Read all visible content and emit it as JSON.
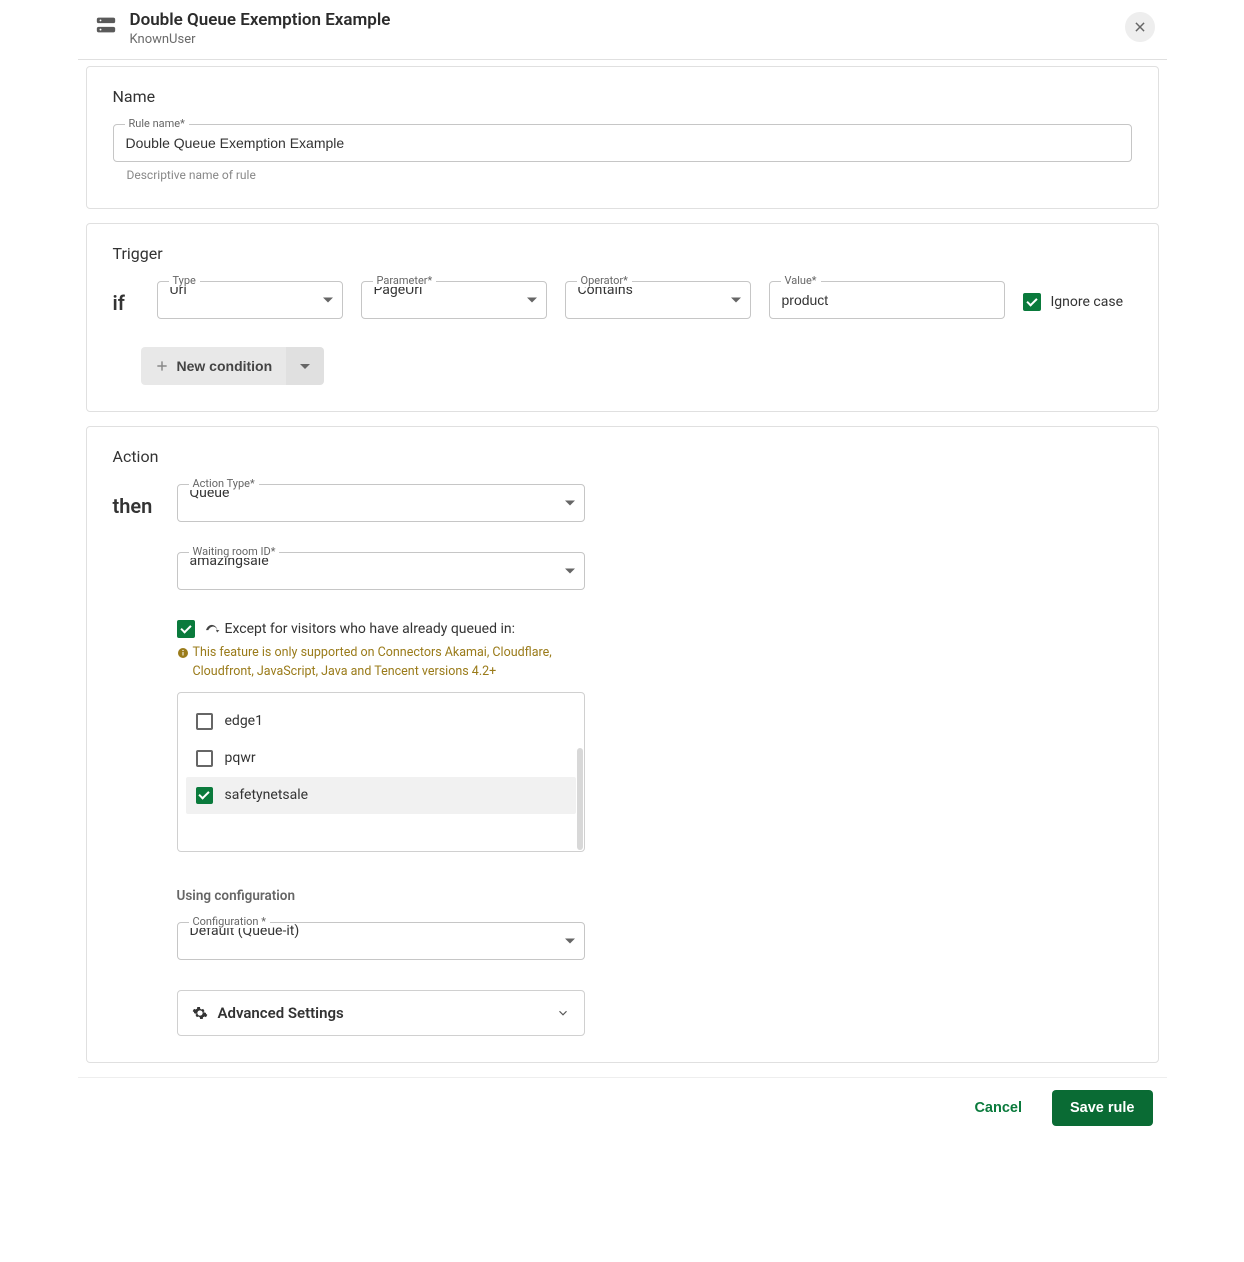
{
  "header": {
    "title": "Double Queue Exemption Example",
    "subtitle": "KnownUser"
  },
  "name_section": {
    "heading": "Name",
    "field_label": "Rule name*",
    "value": "Double Queue Exemption Example",
    "helper": "Descriptive name of rule"
  },
  "trigger_section": {
    "heading": "Trigger",
    "if_label": "if",
    "type_label": "Type",
    "type_value": "Url",
    "parameter_label": "Parameter*",
    "parameter_value": "PageUrl",
    "operator_label": "Operator*",
    "operator_value": "Contains",
    "value_label": "Value*",
    "value_value": "product",
    "ignore_case_label": "Ignore case",
    "ignore_case_checked": true,
    "new_condition_label": "New condition"
  },
  "action_section": {
    "heading": "Action",
    "then_label": "then",
    "action_type_label": "Action Type*",
    "action_type_value": "Queue",
    "waiting_room_label": "Waiting room ID*",
    "waiting_room_value": "amazingsale",
    "except_label": "Except for visitors who have already queued in:",
    "except_checked": true,
    "feature_note": "This feature is only supported on Connectors Akamai, Cloudflare, Cloudfront, JavaScript, Java and Tencent versions 4.2+",
    "rooms": [
      {
        "label": "edge1",
        "checked": false
      },
      {
        "label": "pqwr",
        "checked": false
      },
      {
        "label": "safetynetsale",
        "checked": true
      }
    ],
    "using_config_heading": "Using configuration",
    "config_label": "Configuration *",
    "config_value": "Default (Queue-it)",
    "advanced_label": "Advanced Settings"
  },
  "footer": {
    "cancel": "Cancel",
    "save": "Save rule"
  }
}
